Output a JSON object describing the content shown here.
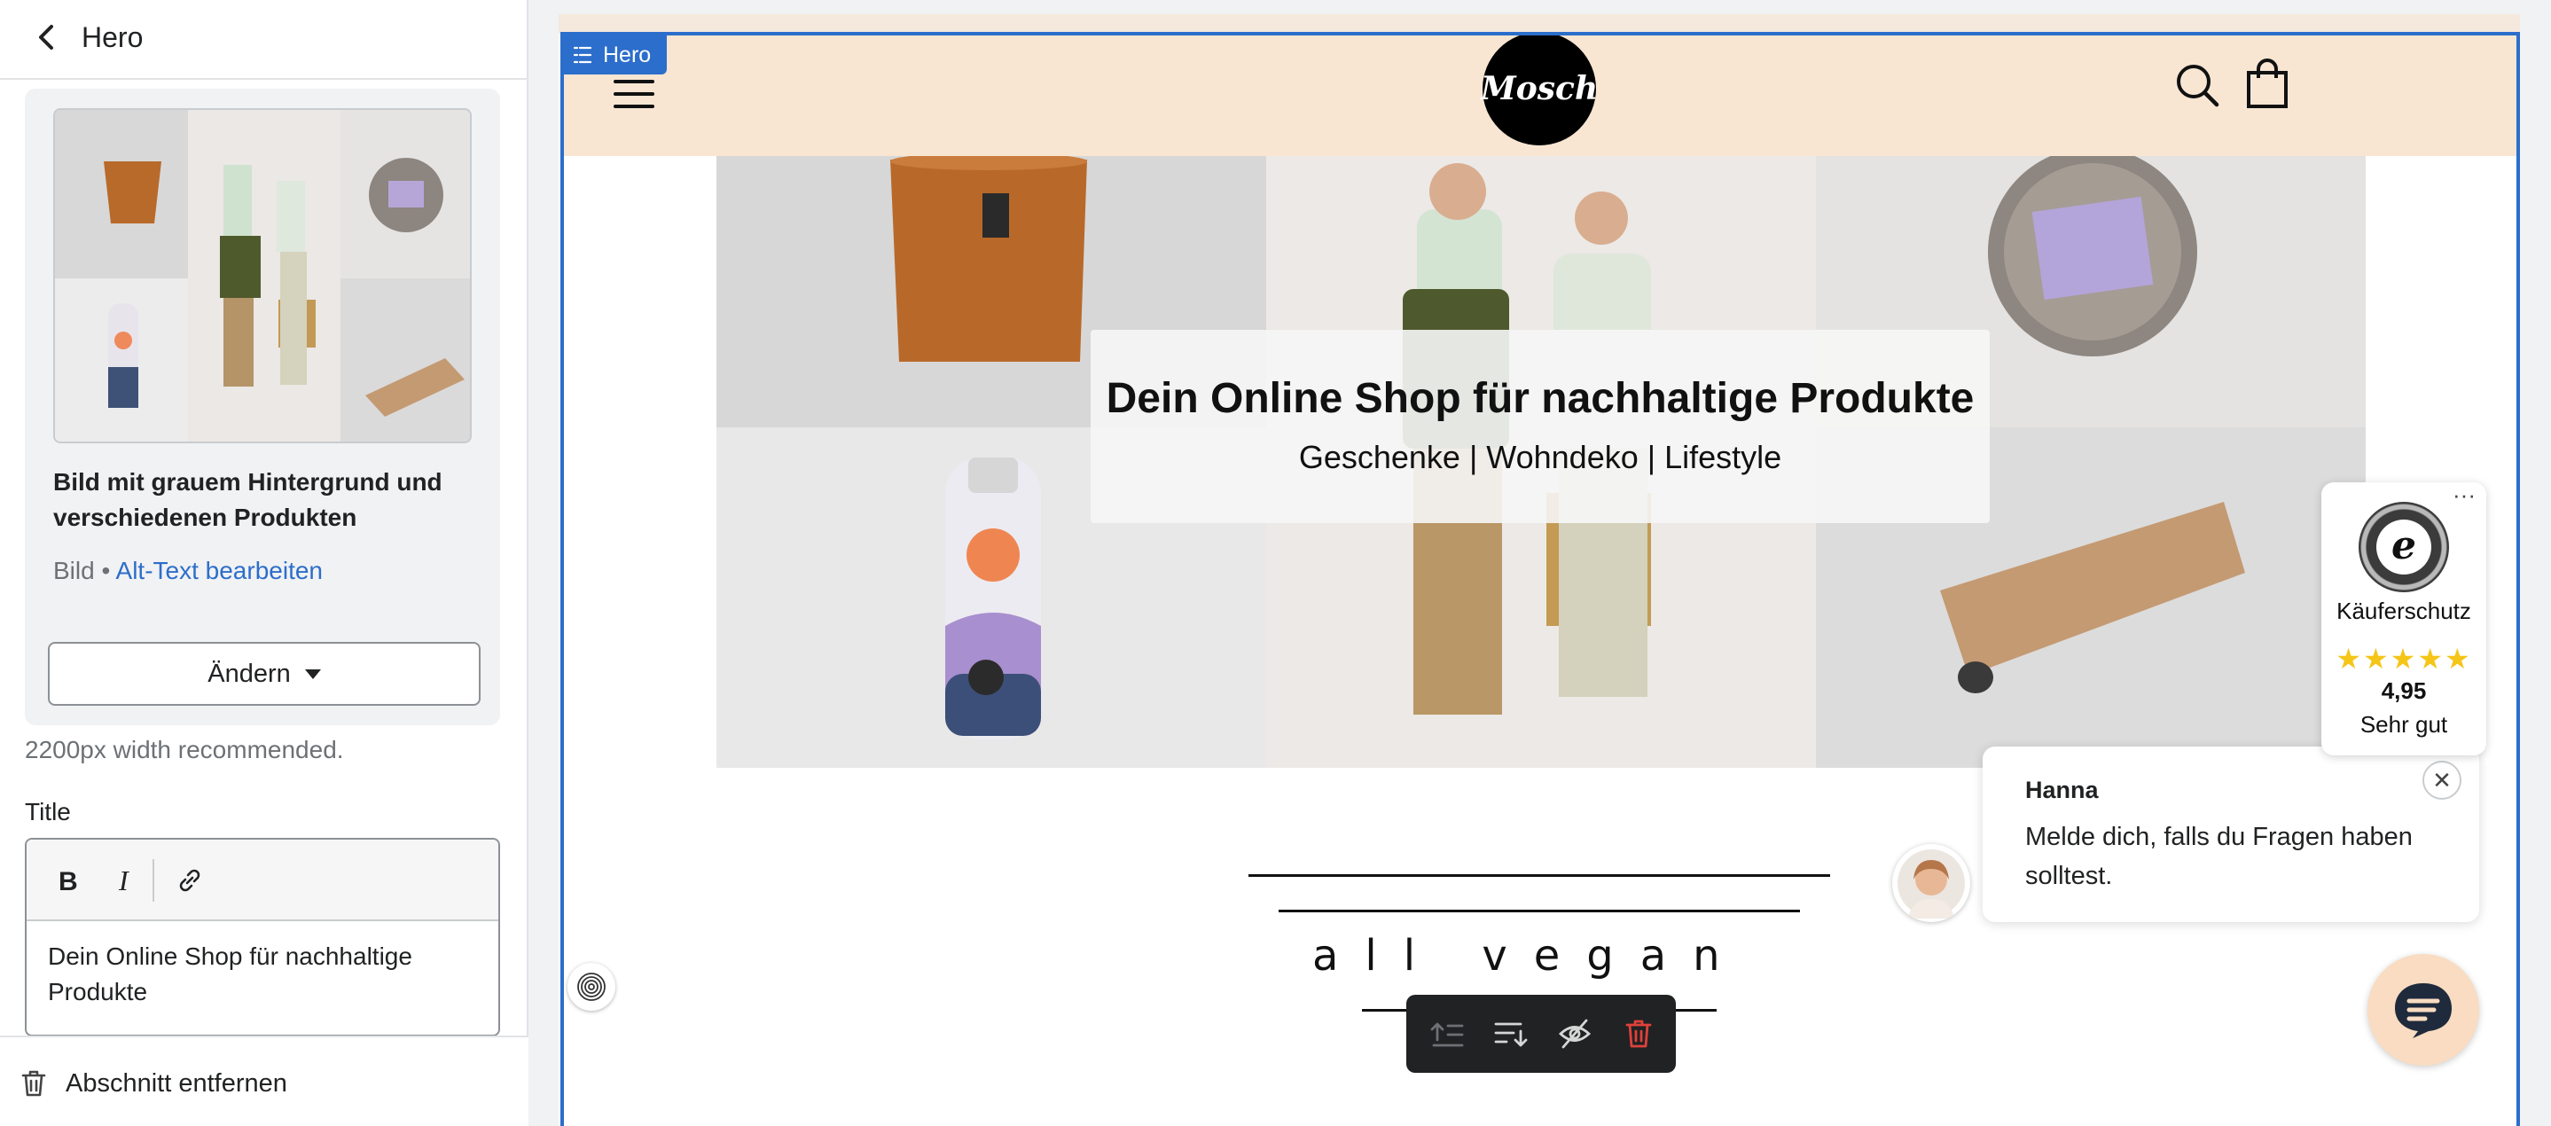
{
  "sidebar": {
    "title": "Hero",
    "image": {
      "alt_name": "Bild mit grauem Hintergrund und verschiedenen Produkten",
      "type_label": "Bild",
      "separator": "•",
      "alt_link": "Alt-Text bearbeiten",
      "change_label": "Ändern"
    },
    "hint": "2200px width recommended.",
    "title_field": {
      "label": "Title",
      "value": "Dein Online Shop für nachhaltige Produkte"
    },
    "remove_label": "Abschnitt entfernen"
  },
  "preview": {
    "section_tag": "Hero",
    "logo_text": "Mosch",
    "hero_title": "Dein Online Shop für nachhaltige Produkte",
    "hero_subtitle": "Geschenke | Wohndeko | Lifestyle",
    "vegan_text": "all vegan",
    "trusted_shops": {
      "seal_letter": "e",
      "label": "Käuferschutz",
      "stars": "★★★★★",
      "score": "4,95",
      "grade": "Sehr gut",
      "menu": "···"
    },
    "chat": {
      "agent_name": "Hanna",
      "message": "Melde dich, falls du Fragen haben solltest.",
      "close": "✕"
    }
  },
  "colors": {
    "accent": "#2c6ecb",
    "store_header": "#f8e6d3",
    "action_bar": "#202223",
    "delete": "#e0413b",
    "stars": "#f5c518"
  },
  "icons": [
    "chevron-left-icon",
    "bold-icon",
    "italic-icon",
    "link-icon",
    "trash-icon",
    "section-icon",
    "hamburger-icon",
    "search-icon",
    "cart-icon",
    "move-up-icon",
    "move-down-icon",
    "hide-icon",
    "delete-icon",
    "fingerprint-icon",
    "chat-icon"
  ]
}
